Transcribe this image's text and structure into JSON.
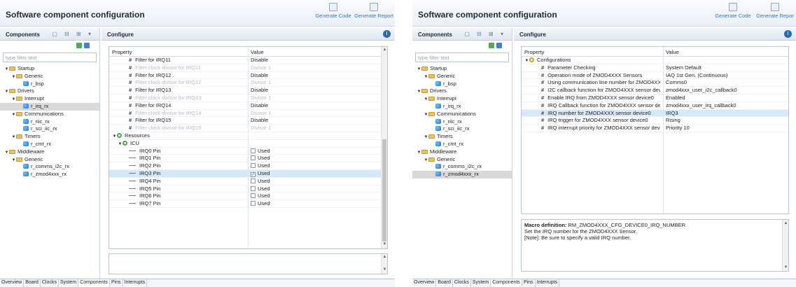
{
  "left": {
    "title": "Software component configuration",
    "generate_code": "Generate Code",
    "generate_report": "Generate Report",
    "components_header": "Components",
    "configure_header": "Configure",
    "filter_placeholder": "type filter text",
    "tree": [
      {
        "label": "Startup",
        "level": 0,
        "type": "folder"
      },
      {
        "label": "Generic",
        "level": 1,
        "type": "folder"
      },
      {
        "label": "r_bsp",
        "level": 2,
        "type": "comp"
      },
      {
        "label": "Drivers",
        "level": 0,
        "type": "folder"
      },
      {
        "label": "Interrupt",
        "level": 1,
        "type": "folder"
      },
      {
        "label": "r_irq_rx",
        "level": 2,
        "type": "comp",
        "selected": true
      },
      {
        "label": "Communications",
        "level": 1,
        "type": "folder"
      },
      {
        "label": "r_riic_rx",
        "level": 2,
        "type": "comp"
      },
      {
        "label": "r_sci_iic_rx",
        "level": 2,
        "type": "comp"
      },
      {
        "label": "Timers",
        "level": 1,
        "type": "folder"
      },
      {
        "label": "r_cmt_rx",
        "level": 2,
        "type": "comp"
      },
      {
        "label": "Middleware",
        "level": 0,
        "type": "folder"
      },
      {
        "label": "Generic",
        "level": 1,
        "type": "folder"
      },
      {
        "label": "r_comms_i2c_rx",
        "level": 2,
        "type": "comp"
      },
      {
        "label": "r_zmod4xxx_rx",
        "level": 2,
        "type": "comp"
      }
    ],
    "table_header": {
      "property": "Property",
      "value": "Value"
    },
    "rows": [
      {
        "p": "Filter for IRQ11",
        "v": "Disable",
        "kind": "hash"
      },
      {
        "p": "Filter clock divisor for IRQ11",
        "v": "Divisor 1",
        "kind": "hash",
        "dis": true
      },
      {
        "p": "Filter for IRQ12",
        "v": "Disable",
        "kind": "hash"
      },
      {
        "p": "Filter clock divisor for IRQ12",
        "v": "Divisor 1",
        "kind": "hash",
        "dis": true
      },
      {
        "p": "Filter for IRQ13",
        "v": "Disable",
        "kind": "hash"
      },
      {
        "p": "Filter clock divisor for IRQ13",
        "v": "Divisor 1",
        "kind": "hash",
        "dis": true
      },
      {
        "p": "Filter for IRQ14",
        "v": "Disable",
        "kind": "hash"
      },
      {
        "p": "Filter clock divisor for IRQ14",
        "v": "Divisor 1",
        "kind": "hash",
        "dis": true
      },
      {
        "p": "Filter for IRQ15",
        "v": "Disable",
        "kind": "hash"
      },
      {
        "p": "Filter clock divisor for IRQ15",
        "v": "Divisor 1",
        "kind": "hash",
        "dis": true
      },
      {
        "p": "Resources",
        "v": "",
        "kind": "group"
      },
      {
        "p": "ICU",
        "v": "",
        "kind": "subgroup"
      },
      {
        "p": "IRQ0 Pin",
        "v": "Used",
        "kind": "pin",
        "checked": false
      },
      {
        "p": "IRQ1 Pin",
        "v": "Used",
        "kind": "pin",
        "checked": false
      },
      {
        "p": "IRQ2 Pin",
        "v": "Used",
        "kind": "pin",
        "checked": false
      },
      {
        "p": "IRQ3 Pin",
        "v": "Used",
        "kind": "pin",
        "checked": true,
        "selected": true
      },
      {
        "p": "IRQ4 Pin",
        "v": "Used",
        "kind": "pin",
        "checked": false
      },
      {
        "p": "IRQ5 Pin",
        "v": "Used",
        "kind": "pin",
        "checked": false
      },
      {
        "p": "IRQ6 Pin",
        "v": "Used",
        "kind": "pin",
        "checked": false
      },
      {
        "p": "IRQ7 Pin",
        "v": "Used",
        "kind": "pin",
        "checked": false
      }
    ],
    "check_mark": "✓",
    "tabs": [
      "Overview",
      "Board",
      "Clocks",
      "System",
      "Components",
      "Pins",
      "Interrupts"
    ],
    "active_tab": "Components"
  },
  "right": {
    "title": "Software component configuration",
    "generate_code": "Generate Code",
    "generate_report": "Generate Repor",
    "components_header": "Components",
    "configure_header": "Configure",
    "filter_placeholder": "type filter text",
    "tree": [
      {
        "label": "Startup",
        "level": 0,
        "type": "folder"
      },
      {
        "label": "Generic",
        "level": 1,
        "type": "folder"
      },
      {
        "label": "r_bsp",
        "level": 2,
        "type": "comp"
      },
      {
        "label": "Drivers",
        "level": 0,
        "type": "folder"
      },
      {
        "label": "Interrupt",
        "level": 1,
        "type": "folder"
      },
      {
        "label": "r_irq_rx",
        "level": 2,
        "type": "comp"
      },
      {
        "label": "Communications",
        "level": 1,
        "type": "folder"
      },
      {
        "label": "r_riic_rx",
        "level": 2,
        "type": "comp"
      },
      {
        "label": "r_sci_iic_rx",
        "level": 2,
        "type": "comp"
      },
      {
        "label": "Timers",
        "level": 1,
        "type": "folder"
      },
      {
        "label": "r_cmt_rx",
        "level": 2,
        "type": "comp"
      },
      {
        "label": "Middleware",
        "level": 0,
        "type": "folder"
      },
      {
        "label": "Generic",
        "level": 1,
        "type": "folder"
      },
      {
        "label": "r_comms_i2c_rx",
        "level": 2,
        "type": "comp"
      },
      {
        "label": "r_zmod4xxx_rx",
        "level": 2,
        "type": "comp",
        "selected": true
      }
    ],
    "table_header": {
      "property": "Property",
      "value": "Value"
    },
    "rows": [
      {
        "p": "Configurations",
        "v": "",
        "kind": "group"
      },
      {
        "p": "Parameter Checking",
        "v": "System Default",
        "kind": "hash"
      },
      {
        "p": "Operation mode of ZMOD4XXX Sensors",
        "v": "IAQ 1st Gen. (Continuous)",
        "kind": "hash"
      },
      {
        "p": "Using communication line number for ZMOD4XX",
        "v": "Comms0",
        "kind": "hash"
      },
      {
        "p": "I2C callback function for ZMOD4XXX sensor devic",
        "v": "zmod4xxx_user_i2c_callback0",
        "kind": "hash"
      },
      {
        "p": "Enable IRQ from ZMOD4XXX sensor device0",
        "v": "Enabled",
        "kind": "hash"
      },
      {
        "p": "IRQ Callback function for ZMOD4XXX sensor devi",
        "v": "zmod4xxx_user_irq_callback0",
        "kind": "hash"
      },
      {
        "p": "IRQ number for ZMOD4XXX sensor device0",
        "v": "IRQ3",
        "kind": "hash",
        "selected": true
      },
      {
        "p": "IRQ trigger for ZMOD4XXX sensor device0",
        "v": "Rising",
        "kind": "hash"
      },
      {
        "p": "IRQ interrupt priority for ZMOD4XXX sensor devic",
        "v": "Priority 10",
        "kind": "hash"
      }
    ],
    "macro_label": "Macro definition:",
    "macro_name": "RM_ZMOD4XXX_CFG_DEVICE0_IRQ_NUMBER",
    "macro_line2": "Set the IRQ number for the ZMOD4XXX Sensor.",
    "macro_line3": "[Note]: Be sure to specify a valid IRQ number.",
    "tabs": [
      "Overview",
      "Board",
      "Clocks",
      "System",
      "Components",
      "Pins",
      "Interrupts"
    ],
    "active_tab": "Components"
  }
}
